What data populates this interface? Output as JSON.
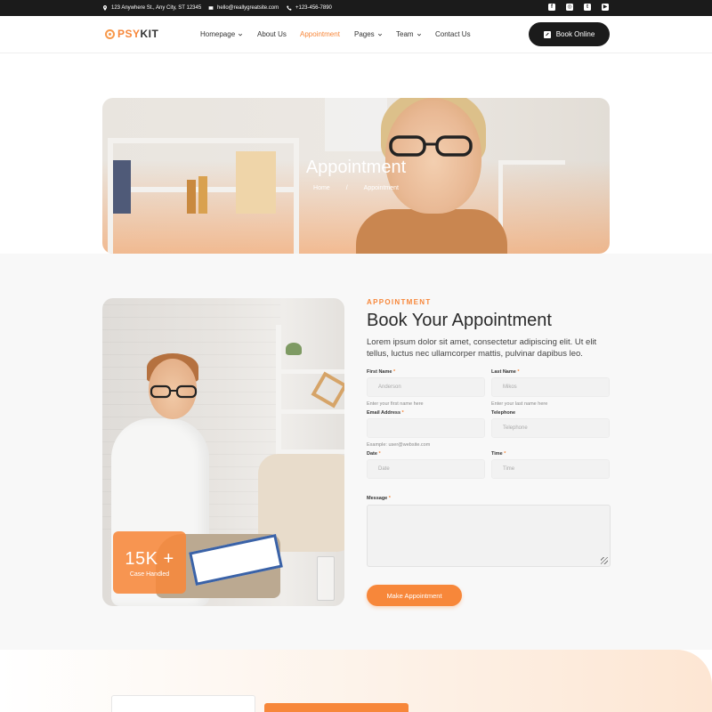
{
  "topbar": {
    "address": "123 Anywhere St., Any City, ST 12345",
    "email": "hello@reallygreatsite.com",
    "phone": "+123-456-7890",
    "socials": [
      "facebook-icon",
      "instagram-icon",
      "twitter-icon",
      "youtube-icon"
    ]
  },
  "header": {
    "logo_a": "PSY",
    "logo_b": "KIT",
    "nav": [
      {
        "label": "Homepage",
        "dropdown": true
      },
      {
        "label": "About Us",
        "dropdown": false
      },
      {
        "label": "Appointment",
        "dropdown": false,
        "active": true
      },
      {
        "label": "Pages",
        "dropdown": true
      },
      {
        "label": "Team",
        "dropdown": true
      },
      {
        "label": "Contact Us",
        "dropdown": false
      }
    ],
    "cta": "Book Online"
  },
  "hero": {
    "title": "Appointment",
    "breadcrumb": [
      "Home",
      "/",
      "Appointment"
    ]
  },
  "stat": {
    "number": "15K +",
    "label": "Case Handled"
  },
  "form": {
    "eyebrow": "APPOINTMENT",
    "heading": "Book Your Appointment",
    "lead": "Lorem ipsum dolor sit amet, consectetur adipiscing elit. Ut elit tellus, luctus nec ullamcorper mattis, pulvinar dapibus leo.",
    "first_name": {
      "label": "First Name",
      "placeholder": "Anderson",
      "hint": "Enter your first name here"
    },
    "last_name": {
      "label": "Last Name",
      "placeholder": "Mikos",
      "hint": "Enter your last name here"
    },
    "email": {
      "label": "Email Address",
      "placeholder": "",
      "hint": "Example: user@website.com"
    },
    "telephone": {
      "label": "Telephone",
      "placeholder": "Telephone"
    },
    "date": {
      "label": "Date",
      "placeholder": "Date"
    },
    "time": {
      "label": "Time",
      "placeholder": "Time"
    },
    "message": {
      "label": "Message"
    },
    "required_mark": "*",
    "submit": "Make Appointment"
  },
  "colors": {
    "accent": "#f7873a",
    "dark": "#1b1b1b"
  }
}
